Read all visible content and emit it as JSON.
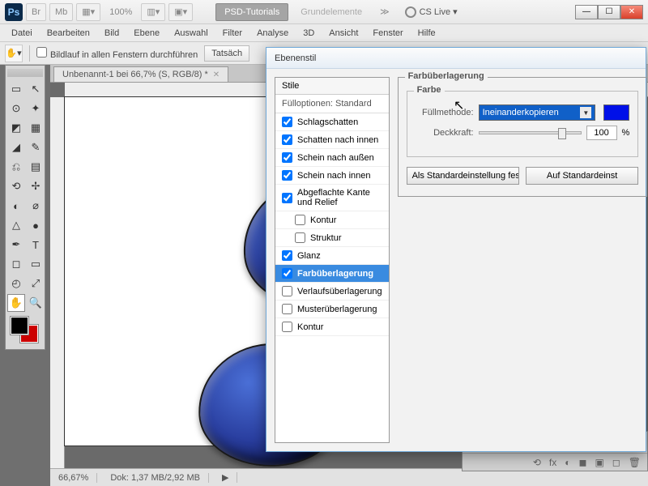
{
  "titlebar": {
    "br": "Br",
    "mb": "Mb",
    "zoom": "100%",
    "tab_active": "PSD-Tutorials",
    "tab_inactive": "Grundelemente",
    "more": "≫",
    "cslive": "CS Live ▾"
  },
  "menu": [
    "Datei",
    "Bearbeiten",
    "Bild",
    "Ebene",
    "Auswahl",
    "Filter",
    "Analyse",
    "3D",
    "Ansicht",
    "Fenster",
    "Hilfe"
  ],
  "optionsbar": {
    "checkbox_label": "Bildlauf in allen Fenstern durchführen",
    "btn": "Tatsäch"
  },
  "doc": {
    "tab": "Unbenannt-1 bei 66,7% (S, RGB/8) *"
  },
  "status": {
    "zoom": "66,67%",
    "dok": "Dok: 1,37 MB/2,92 MB"
  },
  "toolsymbols": [
    "▭",
    "↖",
    "⊙",
    "✦",
    "◩",
    "▦",
    "◢",
    "✎",
    "⎌",
    "▤",
    "⟲",
    "✢",
    "◐",
    "⌀",
    "△",
    "●",
    "✒",
    "T",
    "◻",
    "▭",
    "◴",
    "⤢",
    "✋",
    "🔍"
  ],
  "dialog": {
    "title": "Ebenenstil",
    "stile_header": "Stile",
    "fulloptions": "Fülloptionen: Standard",
    "items": [
      {
        "label": "Schlagschatten",
        "checked": true
      },
      {
        "label": "Schatten nach innen",
        "checked": true
      },
      {
        "label": "Schein nach außen",
        "checked": true
      },
      {
        "label": "Schein nach innen",
        "checked": true
      },
      {
        "label": "Abgeflachte Kante und Relief",
        "checked": true
      },
      {
        "label": "Kontur",
        "checked": false,
        "indent": true
      },
      {
        "label": "Struktur",
        "checked": false,
        "indent": true
      },
      {
        "label": "Glanz",
        "checked": true
      },
      {
        "label": "Farbüberlagerung",
        "checked": true,
        "selected": true
      },
      {
        "label": "Verlaufsüberlagerung",
        "checked": false
      },
      {
        "label": "Musterüberlagerung",
        "checked": false
      },
      {
        "label": "Kontur",
        "checked": false
      }
    ],
    "section_title": "Farbüberlagerung",
    "inner_title": "Farbe",
    "blend_label": "Füllmethode:",
    "blend_value": "Ineinanderkopieren",
    "opacity_label": "Deckkraft:",
    "opacity_value": "100",
    "opacity_unit": "%",
    "btn_default": "Als Standardeinstellung festlegen",
    "btn_reset": "Auf Standardeinst"
  },
  "layerstrip_icons": [
    "⟲",
    "fx",
    "◐",
    "◼",
    "▣",
    "◻",
    "🗑"
  ]
}
